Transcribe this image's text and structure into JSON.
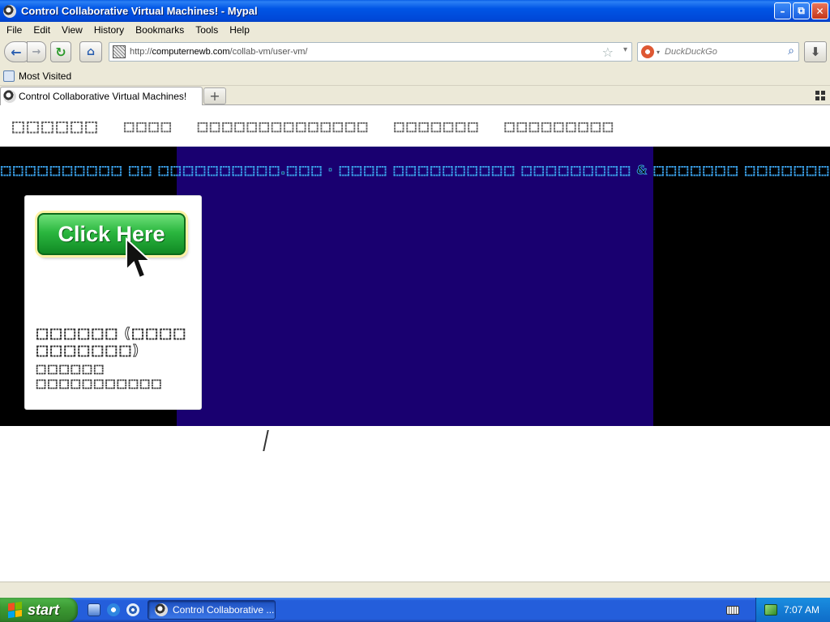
{
  "window": {
    "title": "Control Collaborative Virtual Machines! - Mypal",
    "minimize_glyph": "–",
    "maximize_glyph": "⧉",
    "close_glyph": "✕"
  },
  "menubar": {
    "items": [
      "File",
      "Edit",
      "View",
      "History",
      "Bookmarks",
      "Tools",
      "Help"
    ]
  },
  "navbar": {
    "back_glyph": "←",
    "forward_glyph": "→",
    "reload_glyph": "↻",
    "home_glyph": "⌂",
    "url_prefix": "http://",
    "url_host": "computernewb.com",
    "url_path": "/collab-vm/user-vm/",
    "star_glyph": "☆",
    "dropdown_glyph": "▾",
    "search_placeholder": "DuckDuckGo",
    "search_glyph": "⌕",
    "download_glyph": "⬇"
  },
  "bookmarks": {
    "items": [
      "Most Visited"
    ]
  },
  "tabs": {
    "active_label": "Control Collaborative Virtual Machines!",
    "new_tab_glyph": "+"
  },
  "page": {
    "nav_links": [
      "⬚⬚⬚⬚⬚⬚",
      "⬚⬚⬚⬚",
      "⬚⬚⬚⬚⬚⬚⬚⬚⬚⬚⬚⬚⬚⬚",
      "⬚⬚⬚⬚⬚⬚⬚",
      "⬚⬚⬚⬚⬚⬚⬚⬚⬚"
    ],
    "banner_heading": "⬚⬚⬚⬚⬚⬚⬚⬚⬚⬚ ⬚⬚ ⬚⬚⬚⬚⬚⬚⬚⬚⬚⬚.⬚⬚⬚ · ⬚⬚⬚⬚ ⬚⬚⬚⬚⬚⬚⬚⬚⬚⬚ ⬚⬚⬚⬚⬚⬚⬚⬚⬚ & ⬚⬚⬚⬚⬚⬚⬚ ⬚⬚⬚⬚⬚⬚⬚",
    "promo_button_label": "Click Here",
    "card_title": "⬚⬚⬚⬚⬚⬚ (⬚⬚⬚⬚ ⬚⬚⬚⬚⬚⬚⬚)",
    "card_subtitle": "⬚⬚⬚⬚⬚⬚ ⬚⬚⬚⬚⬚⬚⬚⬚⬚⬚⬚",
    "colors": {
      "banner_outer": "#000000",
      "banner_inner": "#190070",
      "heading_outline": "#3aa0e8",
      "button_green": "#2bb73f"
    }
  },
  "taskbar": {
    "start_label": "start",
    "window_button_label": "Control Collaborative ...",
    "clock": "7:07 AM"
  }
}
